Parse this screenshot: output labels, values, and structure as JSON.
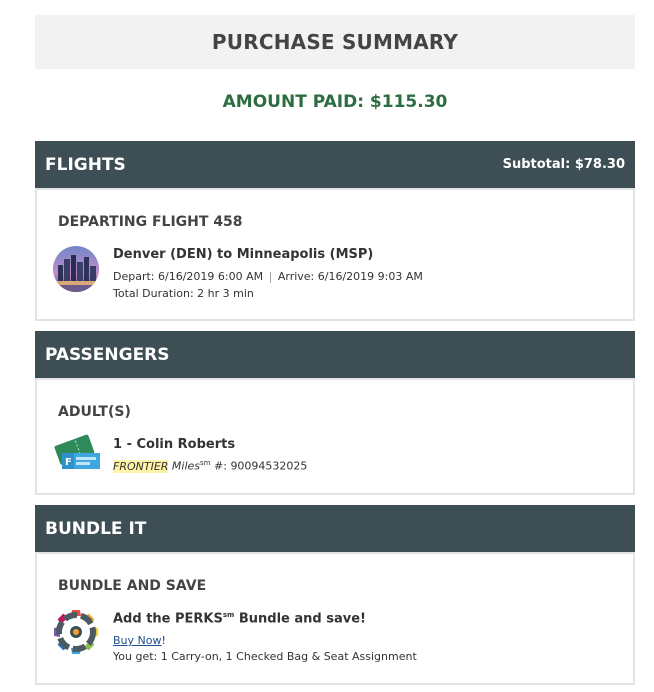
{
  "summary": {
    "title": "PURCHASE SUMMARY",
    "amount_paid": "AMOUNT PAID: $115.30"
  },
  "flights": {
    "header": "FLIGHTS",
    "subtotal": "Subtotal: $78.30",
    "flight_title": "DEPARTING FLIGHT 458",
    "route": "Denver (DEN) to Minneapolis (MSP)",
    "depart": "Depart: 6/16/2019 6:00 AM",
    "separator": "|",
    "arrive": "Arrive: 6/16/2019 9:03 AM",
    "duration": "Total Duration: 2 hr 3 min",
    "icon": "city-skyline-icon"
  },
  "passengers": {
    "header": "PASSENGERS",
    "group_title": "ADULT(S)",
    "passenger_name": "1 - Colin Roberts",
    "program_brand": "FRONTIER",
    "program_miles": "Miles",
    "program_sm": "sm",
    "program_number_label": "#:",
    "program_number": "90094532025",
    "icon": "boarding-pass-icon"
  },
  "bundle": {
    "header": "BUNDLE IT",
    "title": "BUNDLE AND SAVE",
    "offer_prefix": "Add the PERKS",
    "offer_sm": "sm",
    "offer_suffix": "Bundle and save!",
    "buy_now": "Buy Now",
    "buy_now_suffix": "!",
    "you_get": "You get: 1 Carry-on, 1 Checked Bag & Seat Assignment",
    "icon": "gear-bundle-icon"
  },
  "colors": {
    "header_bg": "#3d4e55",
    "amount_green": "#2c6e41",
    "title_bg": "#f2f2f2",
    "highlight": "#fff3a6",
    "link": "#1d4f8c"
  }
}
